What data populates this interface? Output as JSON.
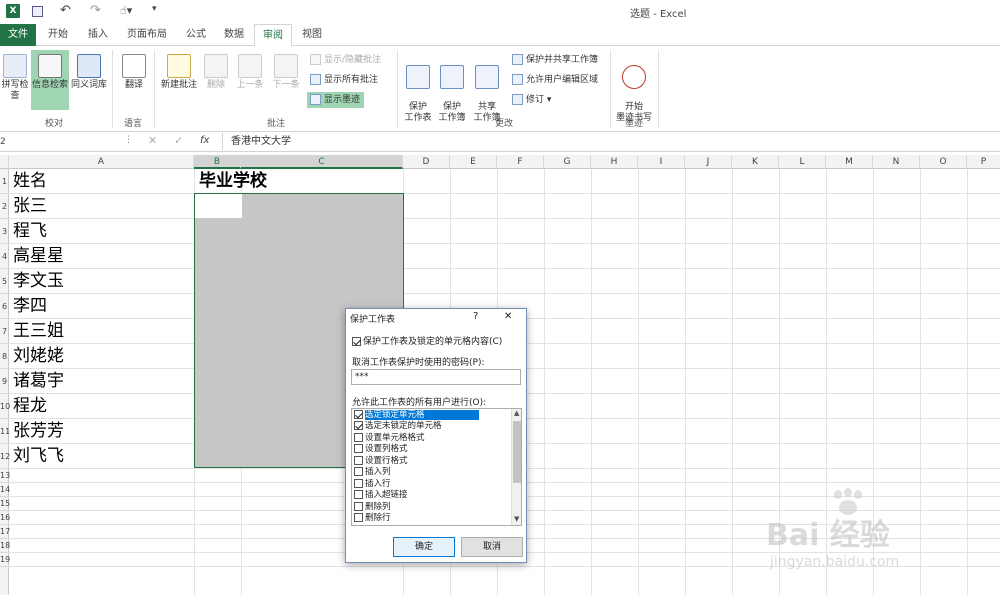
{
  "window": {
    "title": "选题 - Excel"
  },
  "tabs": [
    {
      "label": "文件"
    },
    {
      "label": "开始"
    },
    {
      "label": "插入"
    },
    {
      "label": "页面布局"
    },
    {
      "label": "公式"
    },
    {
      "label": "数据"
    },
    {
      "label": "审阅"
    },
    {
      "label": "视图"
    }
  ],
  "ribbon": {
    "proofing": {
      "spell": "拼写检查",
      "research": "信息检索",
      "thesaurus": "同义词库",
      "group": "校对"
    },
    "language": {
      "translate": "翻译",
      "group": "语言"
    },
    "comments": {
      "new": "新建批注",
      "delete": "删除",
      "prev": "上一条",
      "next": "下一条",
      "showhide": "显示/隐藏批注",
      "showall": "显示所有批注",
      "showink": "显示墨迹",
      "group": "批注"
    },
    "changes": {
      "protect_sheet": "保护\n工作表",
      "protect_book": "保护\n工作簿",
      "share_book": "共享\n工作簿",
      "protect_share": "保护并共享工作簿",
      "allow_edit": "允许用户编辑区域",
      "track": "修订",
      "group": "更改"
    },
    "ink": {
      "start": "开始\n墨迹书写",
      "group": "墨迹"
    }
  },
  "formula_bar": {
    "namebox": "2",
    "fx": "fx",
    "value": "香港中文大学"
  },
  "columns": [
    "A",
    "B",
    "C",
    "D",
    "E",
    "F",
    "G",
    "H",
    "I",
    "J",
    "K",
    "L",
    "M",
    "N",
    "O",
    "P"
  ],
  "rows": [
    "1",
    "2",
    "3",
    "4",
    "5",
    "6",
    "7",
    "8",
    "9",
    "10",
    "11",
    "12",
    "13",
    "14",
    "15",
    "16",
    "17",
    "18",
    "19"
  ],
  "sheet": {
    "header_a": "姓名",
    "header_b": "毕业学校",
    "names": [
      "张三",
      "程飞",
      "高星星",
      "李文玉",
      "李四",
      "王三姐",
      "刘姥姥",
      "诸葛宇",
      "程龙",
      "张芳芳",
      "刘飞飞"
    ]
  },
  "dialog": {
    "title": "保护工作表",
    "help": "?",
    "close": "✕",
    "protect_label": "保护工作表及锁定的单元格内容(C)",
    "password_label": "取消工作表保护时使用的密码(P):",
    "password_value": "***",
    "allow_label": "允许此工作表的所有用户进行(O):",
    "options": [
      {
        "label": "选定锁定单元格",
        "checked": true
      },
      {
        "label": "选定未锁定的单元格",
        "checked": true
      },
      {
        "label": "设置单元格格式",
        "checked": false
      },
      {
        "label": "设置列格式",
        "checked": false
      },
      {
        "label": "设置行格式",
        "checked": false
      },
      {
        "label": "插入列",
        "checked": false
      },
      {
        "label": "插入行",
        "checked": false
      },
      {
        "label": "插入超链接",
        "checked": false
      },
      {
        "label": "删除列",
        "checked": false
      },
      {
        "label": "删除行",
        "checked": false
      }
    ],
    "ok": "确定",
    "cancel": "取消"
  },
  "watermark": {
    "brand": "Bai 经验",
    "url": "jingyan.baidu.com"
  }
}
